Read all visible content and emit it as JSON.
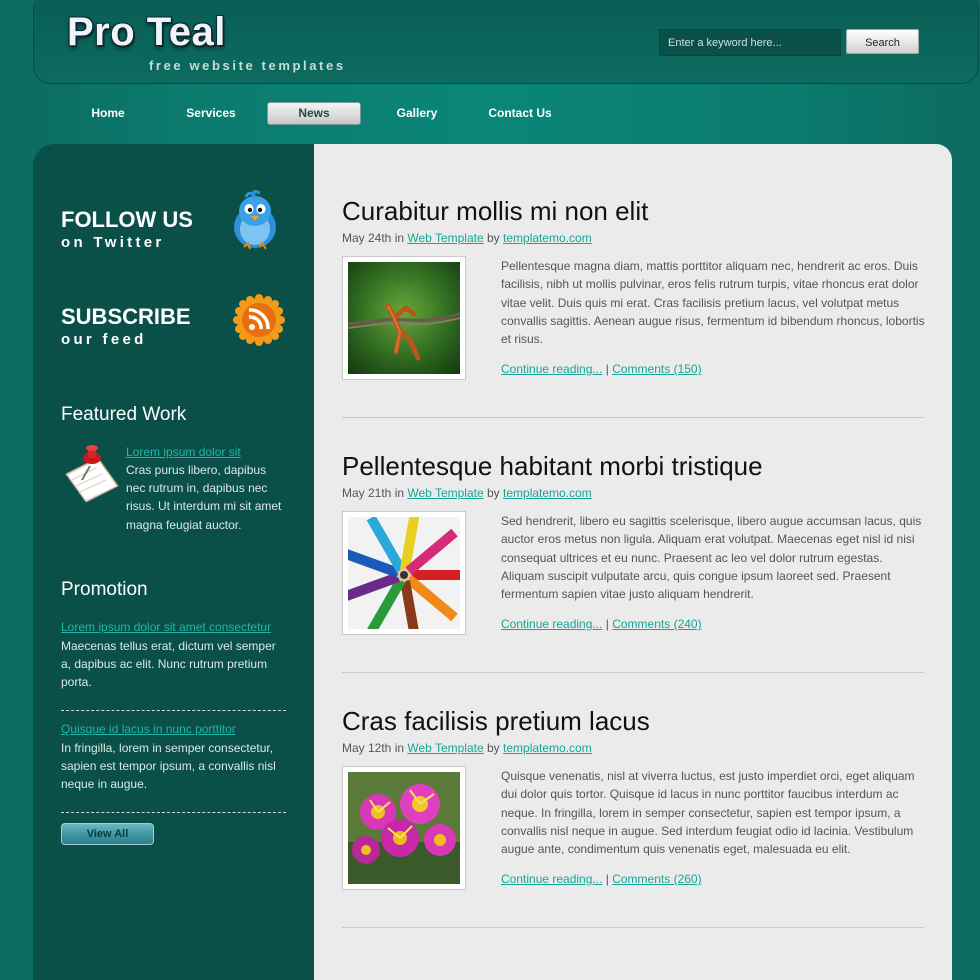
{
  "header": {
    "logo_title": "Pro Teal",
    "logo_tagline": "free website templates",
    "search": {
      "placeholder": "Enter a keyword here...",
      "button_label": "Search"
    }
  },
  "nav": {
    "items": [
      {
        "label": "Home"
      },
      {
        "label": "Services"
      },
      {
        "label": "News",
        "active": true
      },
      {
        "label": "Gallery"
      },
      {
        "label": "Contact Us"
      }
    ]
  },
  "sidebar": {
    "follow": {
      "heading": "FOLLOW US",
      "sub": "on Twitter",
      "icon": "twitter-bird-icon"
    },
    "subscribe": {
      "heading": "SUBSCRIBE",
      "sub": "our feed",
      "icon": "rss-feed-icon"
    },
    "featured": {
      "heading": "Featured Work",
      "link": "Lorem ipsum dolor sit",
      "text": "Cras purus libero, dapibus nec rutrum in, dapibus nec risus. Ut interdum mi sit amet magna feugiat auctor.",
      "icon": "pushpin-note-icon"
    },
    "promotion": {
      "heading": "Promotion",
      "items": [
        {
          "link": "Lorem ipsum dolor sit amet consectetur",
          "text": "Maecenas tellus erat, dictum vel semper a, dapibus ac elit. Nunc rutrum pretium porta."
        },
        {
          "link": "Quisque id lacus in nunc porttitor",
          "text": "In fringilla, lorem in semper consectetur, sapien est tempor ipsum, a convallis nisl neque in augue."
        }
      ],
      "view_all_label": "View All"
    }
  },
  "posts": [
    {
      "title": "Curabitur mollis mi non elit",
      "date": "May 24th",
      "in_word": "in",
      "category": "Web Template",
      "by_word": "by",
      "author": "templatemo.com",
      "image": "barbed-wire-photo",
      "body": "Pellentesque magna diam, mattis porttitor aliquam nec, hendrerit ac eros. Duis facilisis, nibh ut mollis pulvinar, eros felis rutrum turpis, vitae rhoncus erat dolor vitae velit. Duis quis mi erat. Cras facilisis pretium lacus, vel volutpat metus convallis sagittis. Aenean augue risus, fermentum id bibendum rhoncus, lobortis et risus.",
      "continue_label": "Continue reading...",
      "separator": "|",
      "comments_label": "Comments (150)"
    },
    {
      "title": "Pellentesque habitant morbi tristique",
      "date": "May 21th",
      "in_word": "in",
      "category": "Web Template",
      "by_word": "by",
      "author": "templatemo.com",
      "image": "colored-pencils-photo",
      "body": "Sed hendrerit, libero eu sagittis scelerisque, libero augue accumsan lacus, quis auctor eros metus non ligula. Aliquam erat volutpat. Maecenas eget nisl id nisi consequat ultrices et eu nunc. Praesent ac leo vel dolor rutrum egestas. Aliquam suscipit vulputate arcu, quis congue ipsum laoreet sed. Praesent fermentum sapien vitae justo aliquam hendrerit.",
      "continue_label": "Continue reading...",
      "separator": "|",
      "comments_label": "Comments (240)"
    },
    {
      "title": "Cras facilisis pretium lacus",
      "date": "May 12th",
      "in_word": "in",
      "category": "Web Template",
      "by_word": "by",
      "author": "templatemo.com",
      "image": "pink-flowers-photo",
      "body": "Quisque venenatis, nisl at viverra luctus, est justo imperdiet orci, eget aliquam dui dolor quis tortor. Quisque id lacus in nunc porttitor faucibus interdum ac neque. In fringilla, lorem in semper consectetur, sapien est tempor ipsum, a convallis nisl neque in augue. Sed interdum feugiat odio id lacinia. Vestibulum augue ante, condimentum quis venenatis eget, malesuada eu elit.",
      "continue_label": "Continue reading...",
      "separator": "|",
      "comments_label": "Comments (260)"
    }
  ],
  "colors": {
    "teal_bg": "#0a8678",
    "sidebar_bg": "#0b4f49",
    "content_bg": "#ebebeb",
    "link": "#16a596"
  }
}
